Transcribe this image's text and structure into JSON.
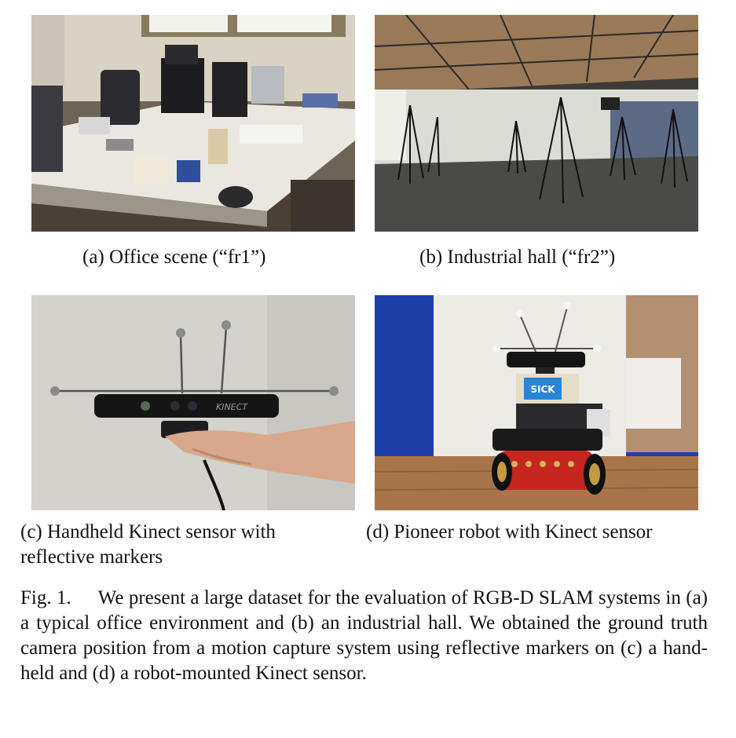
{
  "figure": {
    "subfigures": [
      {
        "label": "(a)",
        "caption": "Office scene (“fr1”)",
        "image": "office-scene-photo"
      },
      {
        "label": "(b)",
        "caption": "Industrial hall (“fr2”)",
        "image": "industrial-hall-photo"
      },
      {
        "label": "(c)",
        "caption": "Handheld Kinect sensor with reflective markers",
        "image": "handheld-kinect-photo"
      },
      {
        "label": "(d)",
        "caption": "Pioneer robot with Kinect sensor",
        "image": "pioneer-robot-photo"
      }
    ],
    "caption_label": "Fig. 1.",
    "caption_text": "We present a large dataset for the evaluation of RGB-D SLAM systems in (a) a typical office environment and (b) an industrial hall. We obtained the ground truth camera position from a motion capture system using reflective markers on (c) a hand-held and (d) a robot-mounted Kinect sensor.",
    "photo_text": {
      "kinect_logo": "KINECT",
      "robot_label": "SICK"
    }
  }
}
